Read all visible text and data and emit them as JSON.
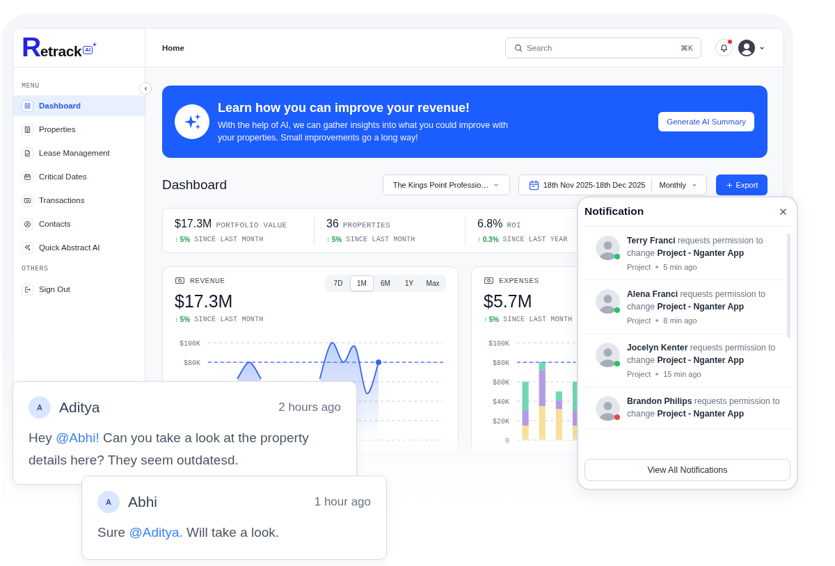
{
  "sidebar": {
    "logo": {
      "wordmark": "Retrack",
      "badge": "AI"
    },
    "sections": [
      {
        "label": "MENU",
        "items": [
          {
            "label": "Dashboard",
            "selected": true
          },
          {
            "label": "Properties",
            "selected": false
          },
          {
            "label": "Lease Management",
            "selected": false
          },
          {
            "label": "Critical Dates",
            "selected": false
          },
          {
            "label": "Transactions",
            "selected": false
          },
          {
            "label": "Contacts",
            "selected": false
          },
          {
            "label": "Quick Abstract AI",
            "selected": false
          }
        ]
      },
      {
        "label": "OTHERS",
        "items": [
          {
            "label": "Sign Out",
            "selected": false
          }
        ]
      }
    ]
  },
  "header": {
    "breadcrumb": "Home",
    "search": {
      "placeholder": "Search",
      "shortcut": "⌘K"
    },
    "notifications": {
      "unread": true
    }
  },
  "banner": {
    "title": "Learn how you can improve your revenue!",
    "text": "With the help of AI, we can gather insights into what you could improve with your properties. Small improvements go a long way!",
    "button": "Generate AI Summary"
  },
  "toolbar": {
    "title": "Dashboard",
    "property": "The Kings Point Professio…",
    "date_range": "18th Nov 2025-18th Dec 2025",
    "period": "Monthly",
    "export_button": "Export"
  },
  "stats": [
    {
      "value": "$17.3M",
      "label": "PORTFOLIO VALUE",
      "change": "↑ 5%",
      "period": "SINCE LAST MONTH"
    },
    {
      "value": "36",
      "label": "PROPERTIES",
      "change": "↑ 5%",
      "period": "SINCE LAST MONTH"
    },
    {
      "value": "6.8%",
      "label": "ROI",
      "change": "↑ 0.3%",
      "period": "SINCE LAST YEAR"
    }
  ],
  "charts": [
    {
      "title": "REVENUE",
      "value": "$17.3M",
      "change": "↑ 5%",
      "period": "SINCE LAST MONTH",
      "ranges": [
        {
          "label": "7D",
          "selected": false
        },
        {
          "label": "1M",
          "selected": true
        },
        {
          "label": "6M",
          "selected": false
        },
        {
          "label": "1Y",
          "selected": false
        },
        {
          "label": "Max",
          "selected": false
        }
      ],
      "chart_data": {
        "type": "area",
        "grid": true,
        "ylim": [
          0,
          100
        ],
        "yticks": [
          {
            "value": 80,
            "label": "$80K"
          },
          {
            "value": 100,
            "label": "$100K"
          }
        ],
        "series": [
          {
            "color": "#2f64f5",
            "values": [
              null,
              null,
              63,
              80,
              63,
              null,
              null,
              null,
              null,
              63,
              100,
              80,
              96,
              48,
              80,
              null,
              null,
              null,
              null,
              null
            ]
          }
        ],
        "ref_lines": [
          {
            "axis": "y",
            "value": 80,
            "color": "#4f7ef7"
          }
        ]
      }
    },
    {
      "title": "EXPENSES",
      "value": "$5.7M",
      "change": "↑ 5%",
      "period": "SINCE LAST MONTH",
      "chart_data": {
        "type": "bar",
        "stacked": true,
        "grid": true,
        "ylim": [
          0,
          100
        ],
        "yticks": [
          {
            "value": 0,
            "label": "0"
          },
          {
            "value": 20,
            "label": "$20K"
          },
          {
            "value": 40,
            "label": "$40K"
          },
          {
            "value": 60,
            "label": "$60K"
          },
          {
            "value": 80,
            "label": "$80K"
          },
          {
            "value": 100,
            "label": "$100K"
          }
        ],
        "series": [
          {
            "color": "#f9df9c",
            "values": [
              15,
              35,
              32,
              15,
              null,
              null,
              null,
              null,
              null,
              null,
              null,
              null,
              null,
              null
            ]
          },
          {
            "color": "#b39be6",
            "values": [
              15,
              37,
              9,
              15,
              null,
              null,
              null,
              null,
              null,
              null,
              null,
              null,
              null,
              null
            ]
          },
          {
            "color": "#6fd8b3",
            "values": [
              30,
              8,
              9,
              30,
              null,
              null,
              null,
              null,
              null,
              null,
              null,
              null,
              null,
              null
            ]
          }
        ],
        "ref_lines": [
          {
            "axis": "y",
            "value": 80,
            "color": "#4f7ef7"
          }
        ]
      }
    }
  ],
  "notification_panel": {
    "title": "Notification",
    "items": [
      {
        "text": "**Terry Franci** requests permission to change **Project - Nganter App**",
        "category": "Project",
        "time": "5 min ago",
        "color": "#22c55e"
      },
      {
        "text": "**Alena Franci** requests permission to change **Project - Nganter App**",
        "category": "Project",
        "time": "8 min ago",
        "color": "#22c55e"
      },
      {
        "text": "**Jocelyn Kenter** requests permission to change **Project - Nganter App**",
        "category": "Project",
        "time": "15 min ago",
        "color": "#22c55e"
      },
      {
        "text": "**Brandon Philips** requests permission to change **Project - Nganter App**",
        "color": "#ef4444"
      }
    ],
    "button": "View All Notifications"
  },
  "comments": [
    {
      "initial": "A",
      "author": "Aditya",
      "time": "2 hours ago",
      "body": [
        {
          "kind": "text",
          "text": "Hey "
        },
        {
          "kind": "mention",
          "text": "@Abhi!"
        },
        {
          "kind": "text",
          "text": " Can you take a look at the property details here? They seem outdatesd."
        }
      ]
    },
    {
      "initial": "A",
      "author": "Abhi",
      "time": "1 hour ago",
      "body": [
        {
          "kind": "text",
          "text": "Sure "
        },
        {
          "kind": "mention",
          "text": "@Aditya."
        },
        {
          "kind": "text",
          "text": " Will take a look."
        }
      ]
    }
  ]
}
